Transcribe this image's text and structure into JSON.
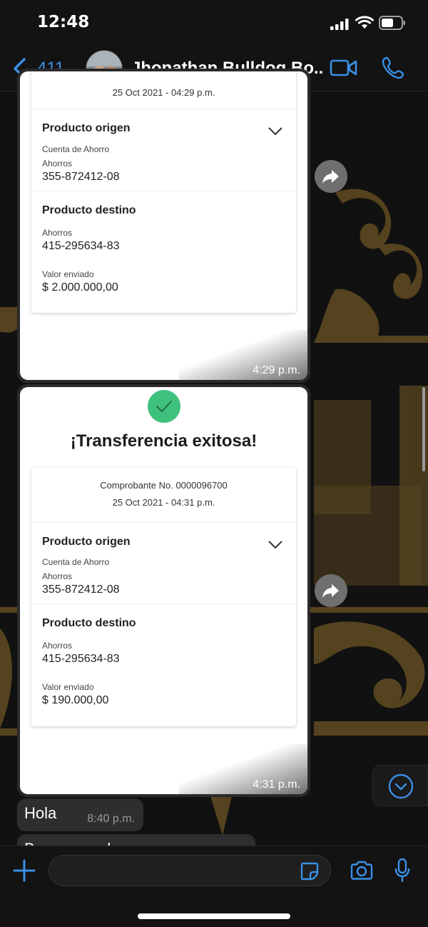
{
  "status_bar": {
    "time": "12:48"
  },
  "header": {
    "back_count": "411",
    "chat_title": "Jhonathan Bulldog Bo..."
  },
  "message1": {
    "date_partial": "25 Oct 2021 - 04:29 p.m.",
    "origin_title": "Producto origen",
    "origin_type": "Cuenta de Ahorro",
    "origin_subtype": "Ahorros",
    "origin_number": "355-872412-08",
    "dest_title": "Producto destino",
    "dest_subtype": "Ahorros",
    "dest_number": "415-295634-83",
    "amount_label": "Valor enviado",
    "amount": "$ 2.000.000,00",
    "time": "4:29 p.m."
  },
  "message2": {
    "success_title": "¡Transferencia exitosa!",
    "receipt_number": "Comprobante No. 0000096700",
    "receipt_date": "25 Oct 2021 - 04:31 p.m.",
    "origin_title": "Producto origen",
    "origin_type": "Cuenta de Ahorro",
    "origin_subtype": "Ahorros",
    "origin_number": "355-872412-08",
    "dest_title": "Producto destino",
    "dest_subtype": "Ahorros",
    "dest_number": "415-295634-83",
    "amount_label": "Valor enviado",
    "amount": "$ 190.000,00",
    "time": "4:31 p.m."
  },
  "message3": {
    "text": "Hola",
    "time": "8:40 p.m."
  },
  "message4": {
    "text_partial": "Buenas noches"
  },
  "input": {
    "placeholder": ""
  },
  "colors": {
    "accent": "#3a8fe6",
    "success": "#3fc17e",
    "bubble": "#2e2e2e",
    "wallpaper_gold": "#9a7a3c"
  }
}
